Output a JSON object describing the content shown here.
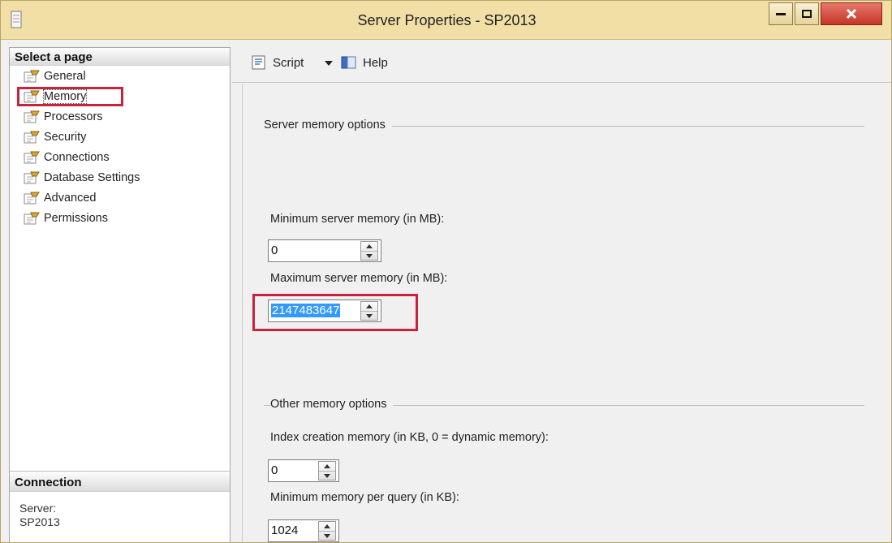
{
  "window": {
    "title": "Server Properties - SP2013",
    "minimize_icon": "minimize-icon",
    "maximize_icon": "maximize-icon",
    "close_icon": "close-icon"
  },
  "left_pane": {
    "header": "Select a page",
    "pages": [
      {
        "label": "General",
        "icon": "wrench-page-icon",
        "selected": false
      },
      {
        "label": "Memory",
        "icon": "wrench-page-icon",
        "selected": true
      },
      {
        "label": "Processors",
        "icon": "wrench-page-icon",
        "selected": false
      },
      {
        "label": "Security",
        "icon": "wrench-page-icon",
        "selected": false
      },
      {
        "label": "Connections",
        "icon": "wrench-page-icon",
        "selected": false
      },
      {
        "label": "Database Settings",
        "icon": "wrench-page-icon",
        "selected": false
      },
      {
        "label": "Advanced",
        "icon": "wrench-page-icon",
        "selected": false
      },
      {
        "label": "Permissions",
        "icon": "wrench-page-icon",
        "selected": false
      }
    ],
    "connection": {
      "header": "Connection",
      "server_label": "Server:",
      "server_value": "SP2013"
    }
  },
  "toolbar": {
    "script_label": "Script",
    "help_label": "Help"
  },
  "memory": {
    "server_group": "Server memory options",
    "min_label": "Minimum server memory (in MB):",
    "min_value": "0",
    "max_label": "Maximum server memory (in MB):",
    "max_value": "2147483647",
    "other_group": "Other memory options",
    "index_label": "Index creation memory (in KB, 0 = dynamic memory):",
    "index_value": "0",
    "query_label": "Minimum memory per query (in KB):",
    "query_value": "1024"
  },
  "colors": {
    "highlight_border": "#c8233d",
    "selection": "#3399ff",
    "title_bar": "#f1dfa6"
  }
}
